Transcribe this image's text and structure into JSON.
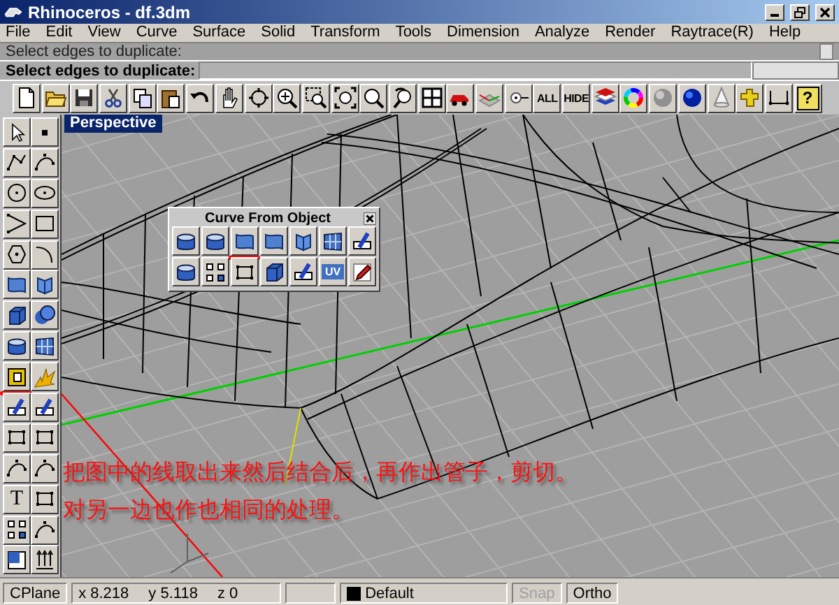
{
  "window": {
    "title": "Rhinoceros - df.3dm"
  },
  "menu": [
    "File",
    "Edit",
    "View",
    "Curve",
    "Surface",
    "Solid",
    "Transform",
    "Tools",
    "Dimension",
    "Analyze",
    "Render",
    "Raytrace(R)",
    "Help"
  ],
  "command_history": "Select edges to duplicate:",
  "command_prompt": "Select edges to duplicate:",
  "toolbar": [
    {
      "kind": "icon"
    },
    {
      "kind": "icon"
    },
    {
      "kind": "icon"
    },
    {
      "kind": "icon"
    },
    {
      "kind": "icon"
    },
    {
      "kind": "icon"
    },
    {
      "kind": "icon"
    },
    {
      "kind": "icon"
    },
    {
      "kind": "icon"
    },
    {
      "kind": "icon"
    },
    {
      "kind": "icon"
    },
    {
      "kind": "icon"
    },
    {
      "kind": "icon"
    },
    {
      "kind": "icon"
    },
    {
      "kind": "icon"
    },
    {
      "kind": "icon"
    },
    {
      "kind": "icon"
    },
    {
      "kind": "icon"
    },
    {
      "kind": "text",
      "label": "ALL"
    },
    {
      "kind": "text",
      "label": "HIDE"
    },
    {
      "kind": "icon"
    },
    {
      "kind": "icon"
    },
    {
      "kind": "icon"
    },
    {
      "kind": "icon"
    },
    {
      "kind": "icon"
    },
    {
      "kind": "icon"
    },
    {
      "kind": "icon"
    },
    {
      "kind": "text",
      "label": "?"
    }
  ],
  "left_toolbar": [
    {
      "kind": "icon",
      "underlined": false
    },
    {
      "kind": "icon",
      "underlined": false
    },
    {
      "kind": "icon",
      "underlined": false
    },
    {
      "kind": "icon",
      "underlined": false
    },
    {
      "kind": "icon",
      "underlined": false
    },
    {
      "kind": "icon",
      "underlined": false
    },
    {
      "kind": "icon",
      "underlined": false
    },
    {
      "kind": "icon",
      "underlined": false
    },
    {
      "kind": "icon",
      "underlined": false
    },
    {
      "kind": "icon",
      "underlined": false
    },
    {
      "kind": "icon",
      "underlined": false
    },
    {
      "kind": "icon",
      "underlined": false
    },
    {
      "kind": "icon",
      "underlined": false
    },
    {
      "kind": "icon",
      "underlined": false
    },
    {
      "kind": "icon",
      "underlined": false
    },
    {
      "kind": "icon",
      "underlined": false
    },
    {
      "kind": "icon",
      "underlined": true
    },
    {
      "kind": "icon",
      "underlined": false
    },
    {
      "kind": "icon",
      "underlined": false
    },
    {
      "kind": "icon",
      "underlined": false
    },
    {
      "kind": "icon",
      "underlined": false
    },
    {
      "kind": "icon",
      "underlined": false
    },
    {
      "kind": "icon",
      "underlined": false
    },
    {
      "kind": "icon",
      "underlined": false
    },
    {
      "kind": "text",
      "label": "T",
      "underlined": false
    },
    {
      "kind": "icon",
      "underlined": false
    },
    {
      "kind": "icon",
      "underlined": false
    },
    {
      "kind": "icon",
      "underlined": false
    },
    {
      "kind": "icon",
      "underlined": false
    },
    {
      "kind": "icon",
      "underlined": false
    }
  ],
  "viewport": {
    "label": "Perspective",
    "annotations": [
      "把图中的线取出来然后结合后，再作出管子，剪切。",
      "对另一边也作也相同的处理。"
    ]
  },
  "palette": {
    "title": "Curve From Object",
    "buttons": [
      {
        "kind": "icon",
        "underlined": false
      },
      {
        "kind": "icon",
        "underlined": false
      },
      {
        "kind": "icon",
        "underlined": true
      },
      {
        "kind": "icon",
        "underlined": false
      },
      {
        "kind": "icon",
        "underlined": false
      },
      {
        "kind": "icon",
        "underlined": false
      },
      {
        "kind": "icon",
        "underlined": false
      },
      {
        "kind": "icon",
        "underlined": false
      },
      {
        "kind": "icon",
        "underlined": false
      },
      {
        "kind": "icon",
        "underlined": false
      },
      {
        "kind": "icon",
        "underlined": false
      },
      {
        "kind": "icon",
        "underlined": false
      },
      {
        "kind": "text",
        "label": "UV",
        "underlined": false
      },
      {
        "kind": "icon",
        "underlined": false
      }
    ]
  },
  "status_bar": {
    "cplane": "CPlane",
    "x": "x 8.218",
    "y": "y 5.118",
    "z": "z 0",
    "layer": "Default",
    "snap": {
      "label": "Snap",
      "on": false
    },
    "ortho": {
      "label": "Ortho",
      "on": true
    }
  }
}
